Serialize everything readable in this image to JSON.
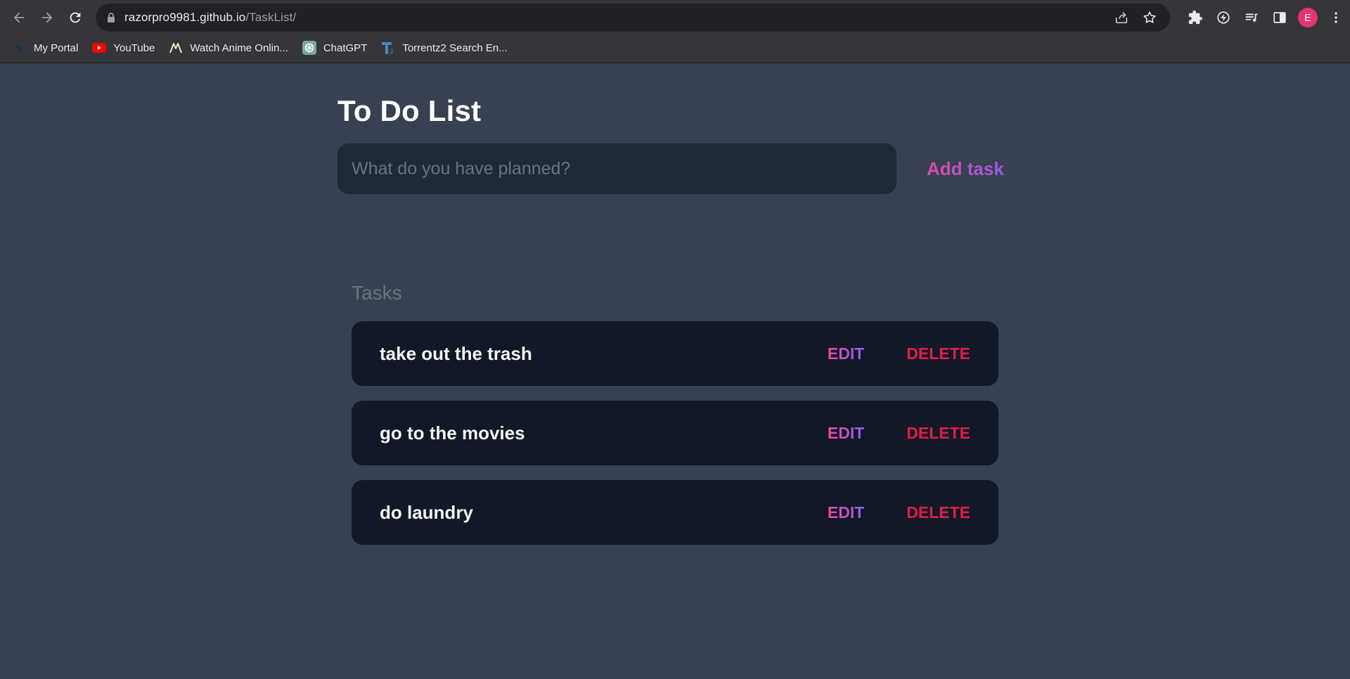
{
  "browser": {
    "url_host": "razorpro9981.github.io",
    "url_path": "/TaskList/",
    "profile_initial": "E",
    "bookmarks": [
      {
        "label": "My Portal",
        "icon": "portal-icon"
      },
      {
        "label": "YouTube",
        "icon": "youtube-icon"
      },
      {
        "label": "Watch Anime Onlin...",
        "icon": "anime-icon"
      },
      {
        "label": "ChatGPT",
        "icon": "chatgpt-icon"
      },
      {
        "label": "Torrentz2 Search En...",
        "icon": "torrentz-icon"
      }
    ]
  },
  "app": {
    "title": "To Do List",
    "input_placeholder": "What do you have planned?",
    "input_value": "",
    "add_label": "Add task",
    "tasks_heading": "Tasks",
    "edit_label": "EDIT",
    "delete_label": "DELETE",
    "tasks": [
      {
        "text": "take out the trash"
      },
      {
        "text": "go to the movies"
      },
      {
        "text": "do laundry"
      }
    ]
  },
  "colors": {
    "page_bg": "#374151",
    "input_bg": "#1f2937",
    "task_bg": "#111827",
    "accent_gradient_start": "#ec4899",
    "accent_gradient_end": "#8b5cf6",
    "delete": "#e11d48"
  }
}
